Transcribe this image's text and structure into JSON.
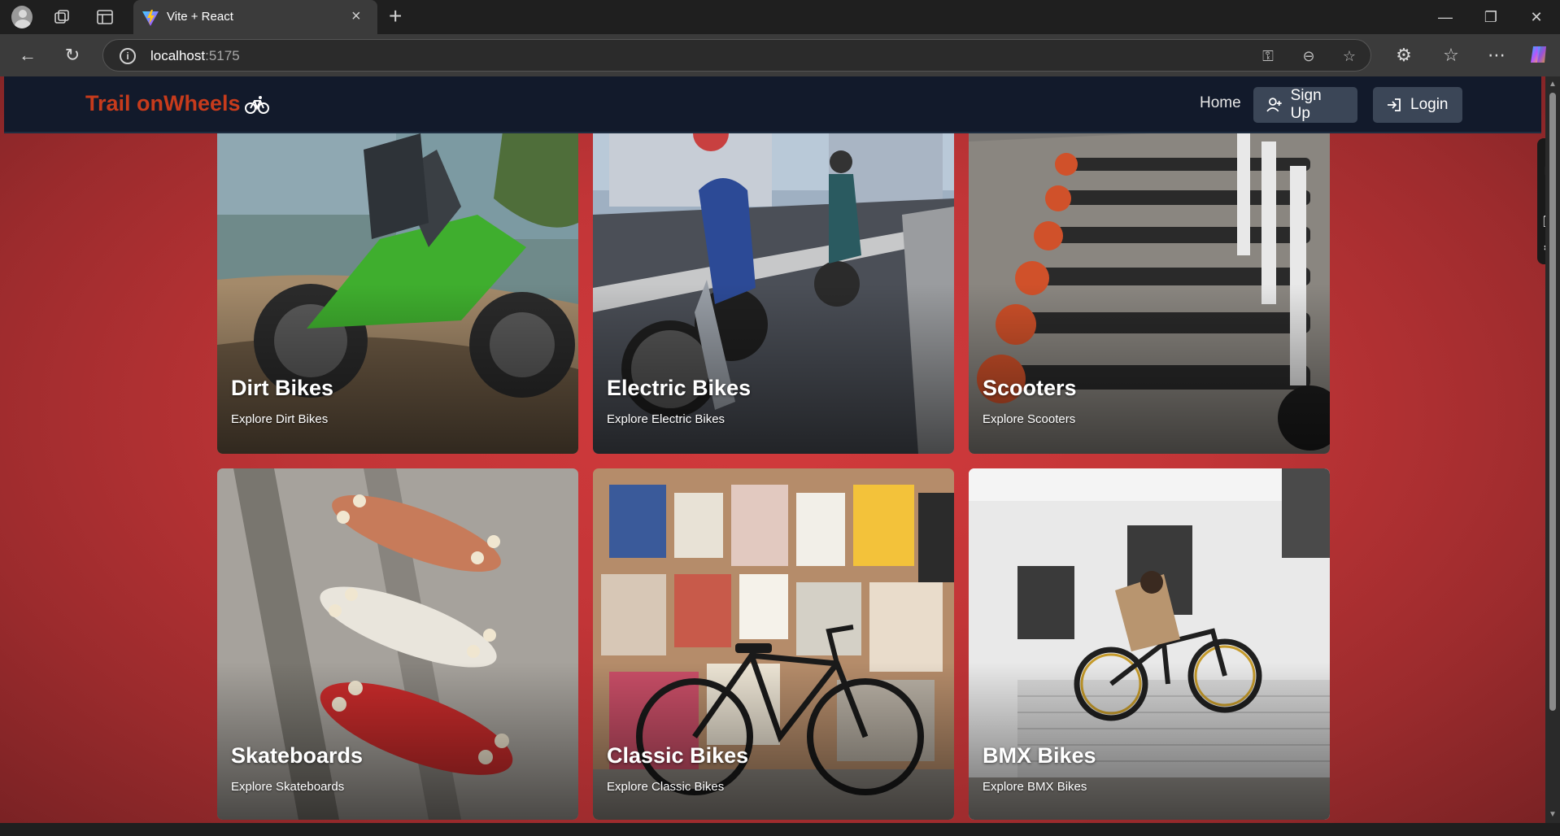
{
  "browser": {
    "tab_title": "Vite + React",
    "tab_close": "×",
    "new_tab": "+",
    "url_host": "localhost",
    "url_port": ":5175",
    "window": {
      "minimize": "—",
      "restore": "❐",
      "close": "✕"
    }
  },
  "navbar": {
    "brand": "Trail onWheels",
    "home": "Home",
    "signup": "Sign Up",
    "login": "Login"
  },
  "cards": [
    {
      "title": "Dirt Bikes",
      "subtitle": "Explore Dirt Bikes"
    },
    {
      "title": "Electric Bikes",
      "subtitle": "Explore Electric Bikes"
    },
    {
      "title": "Scooters",
      "subtitle": "Explore Scooters"
    },
    {
      "title": "Skateboards",
      "subtitle": "Explore Skateboards"
    },
    {
      "title": "Classic Bikes",
      "subtitle": "Explore Classic Bikes"
    },
    {
      "title": "BMX Bikes",
      "subtitle": "Explore BMX Bikes"
    }
  ],
  "colors": {
    "page_bg": "#c23537",
    "navbar_bg": "#121a2b",
    "brand": "#c73b1c",
    "button_bg": "#3b4657"
  }
}
